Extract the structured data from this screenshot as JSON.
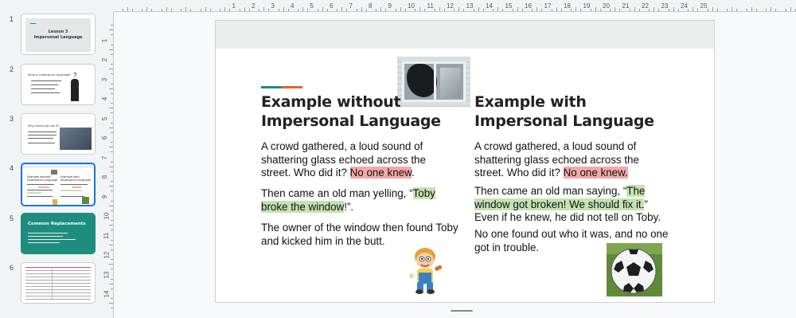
{
  "filmstrip": {
    "slides": [
      {
        "num": "1",
        "title": "Lesson 3",
        "subtitle": "Impersonal Language"
      },
      {
        "num": "2",
        "heading": "What is Impersonal Language?"
      },
      {
        "num": "3",
        "heading": "Why should we use it?"
      },
      {
        "num": "4",
        "heading_left": "Example without Impersonal Language",
        "heading_right": "Example with Impersonal Language",
        "selected": true
      },
      {
        "num": "5",
        "heading": "Common Replacements",
        "bg": "#1e8c7e"
      },
      {
        "num": "6"
      }
    ]
  },
  "ruler": {
    "horizontal": [
      "1",
      "2",
      "3",
      "4",
      "5",
      "6",
      "7",
      "8",
      "9",
      "10",
      "11",
      "12",
      "13",
      "14",
      "15",
      "16",
      "17",
      "18",
      "19",
      "20",
      "21",
      "22",
      "23",
      "24",
      "25"
    ],
    "vertical": [
      "1",
      "2",
      "3",
      "4",
      "5",
      "6",
      "7",
      "8",
      "9",
      "10",
      "11",
      "12",
      "13",
      "14"
    ]
  },
  "slide": {
    "accent_colors": {
      "teal": "#1e8c7e",
      "orange": "#e8622c",
      "red_highlight": "#f4a9a8",
      "green_highlight": "#c4e3b3"
    },
    "left": {
      "title_line1": "Example without",
      "title_line2": "Impersonal Language",
      "p1_text": "A crowd gathered, a loud sound of shattering glass echoed across the street. Who did it? ",
      "p1_highlight": "No one knew",
      "p1_end": ".",
      "p2_text": "Then came an old man yelling, “",
      "p2_highlight": "Toby broke the window",
      "p2_end": "!”.",
      "p3_text": "The owner of the window then found Toby and kicked him in the butt."
    },
    "right": {
      "title_line1": "Example with",
      "title_line2": "Impersonal Language",
      "p1_text": "A crowd gathered, a loud sound of shattering glass echoed across the street. Who did it? ",
      "p1_highlight": "No one knew.",
      "p2_text": "Then came an old man saying, “",
      "p2_highlight": "The window got broken! We should fix it.",
      "p2_end": "” Even if he knew, he did not tell on Toby.",
      "p3_text": "No one found out who it was, and no one got in trouble."
    },
    "images": [
      "broken-window-image",
      "boy-cartoon-image",
      "soccer-ball-image"
    ]
  }
}
